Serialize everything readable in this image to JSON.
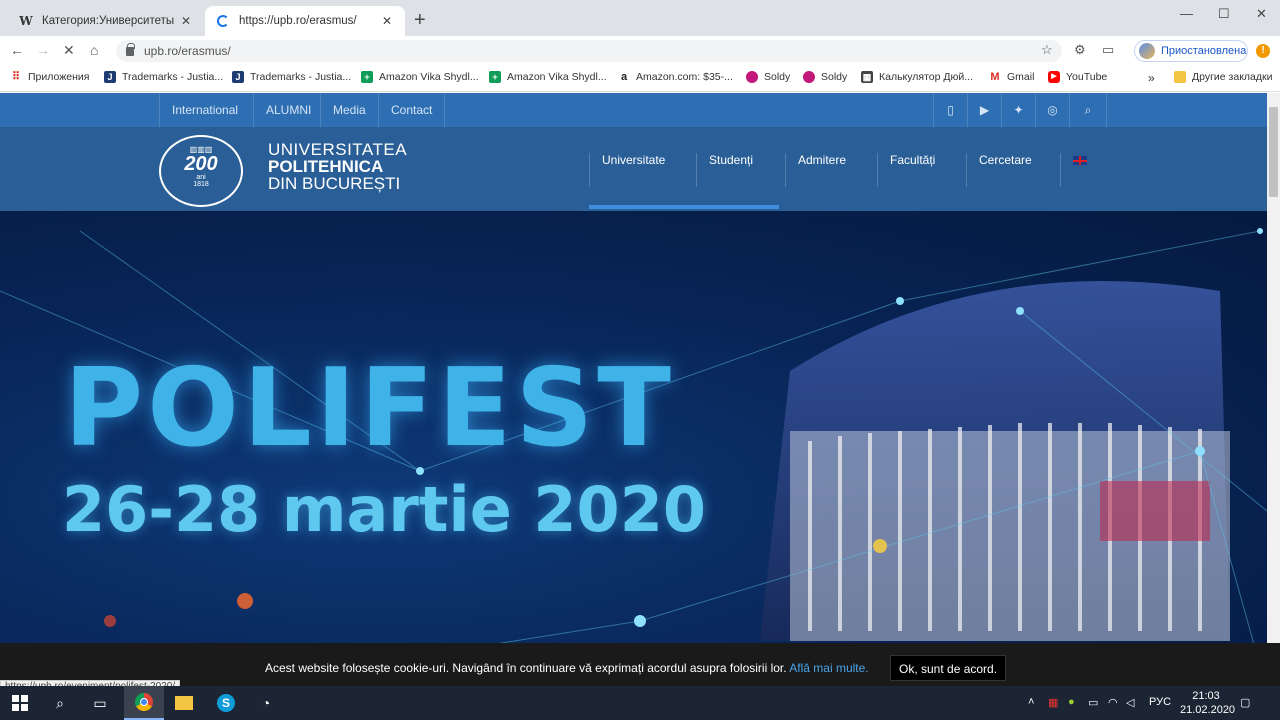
{
  "browser": {
    "tabs": [
      {
        "title": "Категория:Университеты Румы",
        "icon": "wikipedia-icon"
      },
      {
        "title": "https://upb.ro/erasmus/",
        "icon": "loading-spinner-icon"
      }
    ],
    "url": "upb.ro/erasmus/",
    "profile_label": "Приостановлена",
    "alert_label": "!",
    "bookmarks": [
      {
        "label": "Приложения",
        "icon": "apps-grid-icon",
        "color": "#d93025"
      },
      {
        "label": "Trademarks - Justia...",
        "icon": "justia-icon",
        "color": "#1f3b73"
      },
      {
        "label": "Trademarks - Justia...",
        "icon": "justia-icon",
        "color": "#1f3b73"
      },
      {
        "label": "Amazon Vika Shydl...",
        "icon": "sheets-icon",
        "color": "#0f9d58"
      },
      {
        "label": "Amazon Vika Shydl...",
        "icon": "sheets-icon",
        "color": "#0f9d58"
      },
      {
        "label": "Amazon.com: $35-...",
        "icon": "amazon-icon",
        "color": "#222222"
      },
      {
        "label": "Soldy",
        "icon": "soldy-icon",
        "color": "#c2187a"
      },
      {
        "label": "Soldy",
        "icon": "soldy-icon",
        "color": "#c2187a"
      },
      {
        "label": "Калькулятор Дюй...",
        "icon": "calculator-icon",
        "color": "#444444"
      },
      {
        "label": "Gmail",
        "icon": "gmail-icon",
        "color": "#d93025"
      },
      {
        "label": "YouTube",
        "icon": "youtube-icon",
        "color": "#ff0000"
      }
    ],
    "more_bookmarks": "»",
    "other_bookmarks": "Другие закладки"
  },
  "site": {
    "topbar": {
      "links": [
        "International",
        "ALUMNI",
        "Media",
        "Contact"
      ],
      "social_icons": [
        "square-icon",
        "youtube-icon",
        "twitter-icon",
        "instagram-icon",
        "search-icon"
      ]
    },
    "logo": {
      "line1": "UNIVERSITATEA",
      "line2": "POLITEHNICA",
      "line3": "DIN BUCUREȘTI",
      "badge_number": "200",
      "badge_small": "ani",
      "badge_year": "1818"
    },
    "main_nav": [
      "Universitate",
      "Studenți",
      "Admitere",
      "Facultăți",
      "Cercetare"
    ],
    "flag_icon": "uk-flag-icon",
    "hero": {
      "title": "POLIFEST",
      "date": "26-28 martie 2020"
    },
    "cookie": {
      "text": "Acest website folosește cookie-uri. Navigând în continuare vă exprimați acordul asupra folosirii lor.",
      "link": "Află mai multe.",
      "button": "Ok, sunt de acord."
    },
    "status_url": "https://upb.ro/eveniment/polifest-2020/"
  },
  "taskbar": {
    "language": "РУС",
    "time": "21:03",
    "date": "21.02.2020"
  }
}
